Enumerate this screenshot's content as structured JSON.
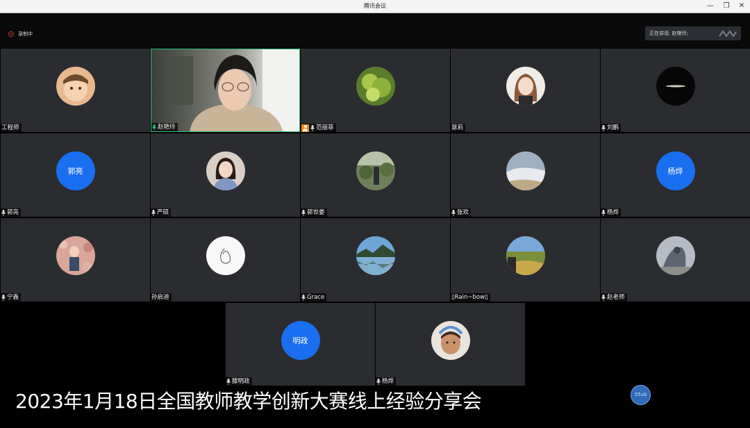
{
  "window": {
    "title": "腾讯会议",
    "minimize": "—",
    "restore": "❐",
    "close": "✕"
  },
  "topbar": {
    "recording_label": "录制中",
    "speaking_label": "正在讲话: 赵艳玲;"
  },
  "participants": [
    {
      "name": "工程师",
      "muted_icon": false
    },
    {
      "name": "赵艳玲",
      "mic": "active"
    },
    {
      "name": "范丽菲",
      "host": true
    },
    {
      "name": "慧莉",
      "muted_icon": false
    },
    {
      "name": "刘鹏"
    },
    {
      "name": "郭亮",
      "avatar_text": "郭亮"
    },
    {
      "name": "严硕"
    },
    {
      "name": "郭世娄"
    },
    {
      "name": "张欢"
    },
    {
      "name": "杨烨",
      "avatar_text": "杨烨"
    },
    {
      "name": "宁鑫"
    },
    {
      "name": "孙启迪",
      "muted_icon": false
    },
    {
      "name": "Grace"
    },
    {
      "name": "▯Rain~bow▯",
      "muted_icon": false
    },
    {
      "name": "赵老师"
    },
    {
      "name": "滕明政",
      "avatar_text": "明政"
    },
    {
      "name": "杨烨"
    }
  ],
  "banner": "2023年1月18日全国教师教学创新大赛线上经验分享会",
  "float_button": "55ub",
  "colors": {
    "accent_blue": "#1a6ff0",
    "active_border": "#2ec27e",
    "tile_bg": "#2a2c30",
    "host_badge": "#f08a1c"
  }
}
